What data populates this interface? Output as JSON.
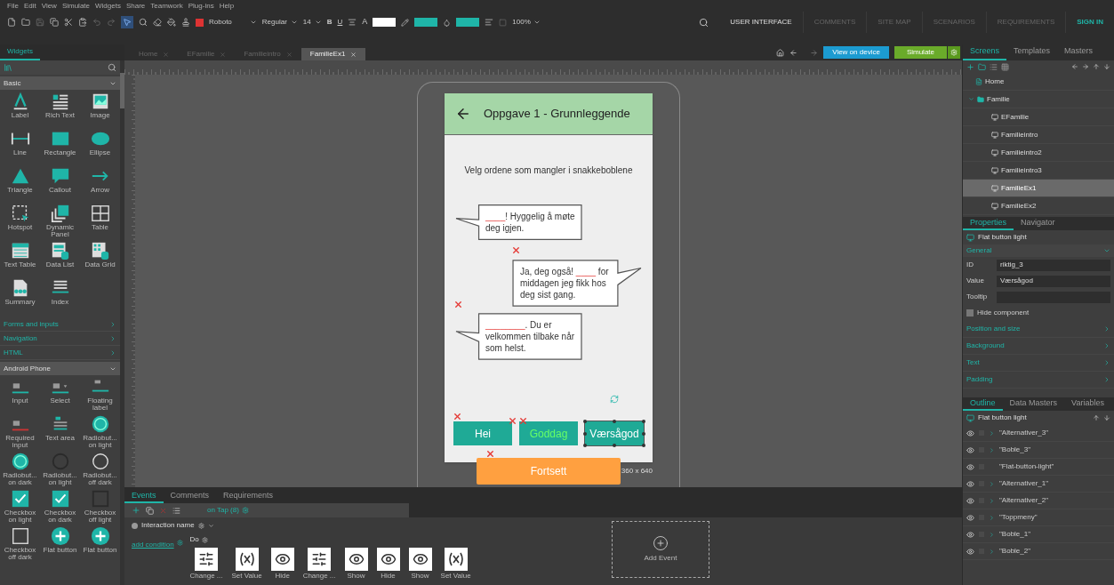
{
  "menu": [
    "File",
    "Edit",
    "View",
    "Simulate",
    "Widgets",
    "Share",
    "Teamwork",
    "Plug-ins",
    "Help"
  ],
  "toolbar": {
    "font": "Roboto",
    "font_style": "Regular",
    "font_size": "14",
    "bold": "B",
    "underline": "U",
    "text_color_label": "A",
    "zoom": "100%",
    "swatches": [
      {
        "color": "#ffffff"
      },
      {
        "color": "#1fb5a8"
      },
      {
        "color": "#1fb5a8"
      }
    ]
  },
  "nav_tabs": [
    {
      "label": "USER INTERFACE",
      "selected": true
    },
    {
      "label": "COMMENTS",
      "selected": false
    },
    {
      "label": "SITE MAP",
      "selected": false
    },
    {
      "label": "SCENARIOS",
      "selected": false
    },
    {
      "label": "REQUIREMENTS",
      "selected": false
    }
  ],
  "sign_in": "SIGN IN",
  "widgets_panel": {
    "tab": "Widgets",
    "sections": [
      {
        "title": "Basic",
        "expanded": true,
        "items": [
          {
            "label": "Label",
            "kind": "label"
          },
          {
            "label": "Rich Text",
            "kind": "rich-text"
          },
          {
            "label": "Image",
            "kind": "image"
          },
          {
            "label": "Line",
            "kind": "line"
          },
          {
            "label": "Rectangle",
            "kind": "rectangle"
          },
          {
            "label": "Ellipse",
            "kind": "ellipse"
          },
          {
            "label": "Triangle",
            "kind": "triangle"
          },
          {
            "label": "Callout",
            "kind": "callout"
          },
          {
            "label": "Arrow",
            "kind": "arrow"
          },
          {
            "label": "Hotspot",
            "kind": "hotspot"
          },
          {
            "label": "Dynamic Panel",
            "kind": "dynamic-panel"
          },
          {
            "label": "Table",
            "kind": "table"
          },
          {
            "label": "Text Table",
            "kind": "text-table"
          },
          {
            "label": "Data List",
            "kind": "data-list"
          },
          {
            "label": "Data Grid",
            "kind": "data-grid"
          },
          {
            "label": "Summary",
            "kind": "summary"
          },
          {
            "label": "Index",
            "kind": "index"
          }
        ]
      },
      {
        "title": "Forms and inputs",
        "expanded": false
      },
      {
        "title": "Navigation",
        "expanded": false
      },
      {
        "title": "HTML",
        "expanded": false
      },
      {
        "title": "Android Phone",
        "expanded": true,
        "items": [
          {
            "label": "Input",
            "kind": "input"
          },
          {
            "label": "Select",
            "kind": "select"
          },
          {
            "label": "Floating label",
            "kind": "floating-label"
          },
          {
            "label": "Required input",
            "kind": "required-input"
          },
          {
            "label": "Text area",
            "kind": "text-area"
          },
          {
            "label": "Radiobut... on light",
            "kind": "radio-on"
          },
          {
            "label": "Radiobut... on dark",
            "kind": "radio-on"
          },
          {
            "label": "Radiobut... on light",
            "kind": "radio-off-light"
          },
          {
            "label": "Radiobut... off dark",
            "kind": "radio-off-dark"
          },
          {
            "label": "Checkbox on light",
            "kind": "checkbox-on"
          },
          {
            "label": "Checkbox on dark",
            "kind": "checkbox-on"
          },
          {
            "label": "Checkbox off light",
            "kind": "checkbox-off-light"
          },
          {
            "label": "Checkbox off dark",
            "kind": "checkbox-off-dark"
          },
          {
            "label": "Flat button",
            "kind": "flat-button"
          },
          {
            "label": "Flat button",
            "kind": "flat-button"
          }
        ]
      }
    ]
  },
  "doc_tabs": [
    {
      "label": "Home",
      "selected": false
    },
    {
      "label": "EFamilie",
      "selected": false
    },
    {
      "label": "Familieintro",
      "selected": false
    },
    {
      "label": "FamilieEx1",
      "selected": true
    }
  ],
  "canvas_actions": {
    "view_on_device": "View on device",
    "simulate": "Simulate"
  },
  "phone": {
    "title": "Oppgave 1 - Grunnleggende",
    "instruction": "Velg ordene som mangler i snakkeboblene",
    "bubbles": [
      {
        "tail_left": true,
        "parts": [
          {
            "text": "____",
            "blank": true
          },
          {
            "text": "! Hyggelig å møte deg igjen.",
            "blank": false
          }
        ]
      },
      {
        "tail_left": false,
        "parts": [
          {
            "text": "Ja, deg også! ",
            "blank": false
          },
          {
            "text": "____",
            "blank": true
          },
          {
            "text": " for middagen jeg fikk hos deg sist gang.",
            "blank": false
          }
        ]
      },
      {
        "tail_left": true,
        "parts": [
          {
            "text": "________",
            "blank": true
          },
          {
            "text": ". Du er velkommen tilbake når som helst.",
            "blank": false
          }
        ]
      }
    ],
    "options": [
      {
        "label": "Hei",
        "selected": false,
        "highlighted": false
      },
      {
        "label": "Goddag",
        "selected": false,
        "highlighted": true
      },
      {
        "label": "Værsågod",
        "selected": true,
        "highlighted": false
      }
    ],
    "continue": "Fortsett",
    "size": "360 x 640"
  },
  "events": {
    "tabs": [
      {
        "label": "Events",
        "selected": true
      },
      {
        "label": "Comments",
        "selected": false
      },
      {
        "label": "Requirements",
        "selected": false
      }
    ],
    "event": "on Tap (8)",
    "interaction": "Interaction name",
    "add_condition": "add condition",
    "do": "Do",
    "actions": [
      {
        "kind": "change",
        "label": "Change ..."
      },
      {
        "kind": "set-value",
        "label": "Set Value"
      },
      {
        "kind": "hide",
        "label": "Hide"
      },
      {
        "kind": "change",
        "label": "Change ..."
      },
      {
        "kind": "show",
        "label": "Show"
      },
      {
        "kind": "hide",
        "label": "Hide"
      },
      {
        "kind": "show",
        "label": "Show"
      },
      {
        "kind": "set-value",
        "label": "Set Value"
      }
    ],
    "add_event": "Add Event"
  },
  "screens": {
    "tabs": [
      {
        "label": "Screens",
        "selected": true
      },
      {
        "label": "Templates",
        "selected": false
      },
      {
        "label": "Masters",
        "selected": false
      }
    ],
    "tree": [
      {
        "label": "Home",
        "kind": "page",
        "selected": false
      },
      {
        "label": "Familie",
        "kind": "folder",
        "selected": false,
        "expanded": true,
        "children": [
          {
            "label": "EFamilie",
            "kind": "screen",
            "selected": false
          },
          {
            "label": "Familieintro",
            "kind": "screen",
            "selected": false
          },
          {
            "label": "Familieintro2",
            "kind": "screen",
            "selected": false
          },
          {
            "label": "Familieintro3",
            "kind": "screen",
            "selected": false
          },
          {
            "label": "FamilieEx1",
            "kind": "screen",
            "selected": true
          },
          {
            "label": "FamilieEx2",
            "kind": "screen",
            "selected": false
          }
        ]
      }
    ]
  },
  "properties": {
    "tabs": [
      {
        "label": "Properties",
        "selected": true
      },
      {
        "label": "Navigator",
        "selected": false
      }
    ],
    "component": "Flat button light",
    "general": "General",
    "fields": [
      {
        "label": "ID",
        "value": "riktig_3"
      },
      {
        "label": "Value",
        "value": "Værsågod"
      },
      {
        "label": "Tooltip"
      }
    ],
    "hide_component": {
      "label": "Hide component",
      "checked": false
    },
    "sections": [
      "Position and size",
      "Background",
      "Text",
      "Padding"
    ]
  },
  "outline": {
    "tabs": [
      {
        "label": "Outline",
        "selected": true
      },
      {
        "label": "Data Masters",
        "selected": false
      },
      {
        "label": "Variables",
        "selected": false
      }
    ],
    "component": "Flat button light",
    "rows": [
      {
        "label": "\"Alternativer_3\"",
        "expandable": true
      },
      {
        "label": "\"Boble_3\"",
        "expandable": true
      },
      {
        "label": "\"Flat-button-light\"",
        "expandable": false
      },
      {
        "label": "\"Alternativer_1\"",
        "expandable": true
      },
      {
        "label": "\"Alternativer_2\"",
        "expandable": true
      },
      {
        "label": "\"Toppmeny\"",
        "expandable": true
      },
      {
        "label": "\"Boble_1\"",
        "expandable": true
      },
      {
        "label": "\"Boble_2\"",
        "expandable": true
      }
    ]
  }
}
